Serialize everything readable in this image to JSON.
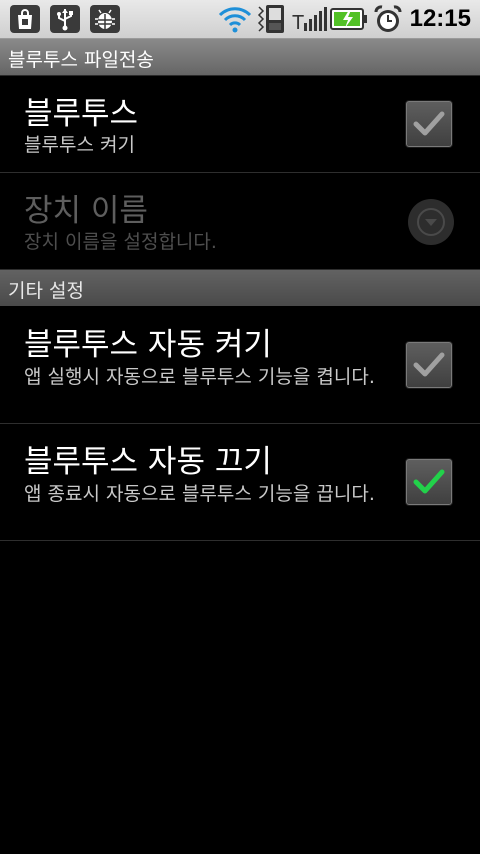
{
  "status_bar": {
    "time": "12:15",
    "icons": [
      "shopping-bag-icon",
      "usb-icon",
      "android-debug-icon",
      "wifi-icon",
      "phone-signal-icon",
      "cell-signal-icon",
      "battery-charging-icon",
      "alarm-clock-icon"
    ]
  },
  "screen": {
    "title": "블루투스 파일전송"
  },
  "preferences": {
    "bluetooth": {
      "title": "블루투스",
      "summary": "블루투스 켜기",
      "checked": true,
      "enabled": true
    },
    "device_name": {
      "title": "장치 이름",
      "summary": "장치 이름을 설정합니다.",
      "enabled": false
    }
  },
  "section_other": {
    "title": "기타 설정",
    "items": [
      {
        "title": "블루투스 자동 켜기",
        "summary": "앱 실행시 자동으로 블루투스 기능을 켭니다.",
        "checked": false
      },
      {
        "title": "블루투스 자동 끄기",
        "summary": "앱 종료시 자동으로 블루투스 기능을 끕니다.",
        "checked": true
      }
    ]
  },
  "colors": {
    "check_active": "#22d14a",
    "check_inactive": "#a0a0a0",
    "background": "#000000"
  }
}
